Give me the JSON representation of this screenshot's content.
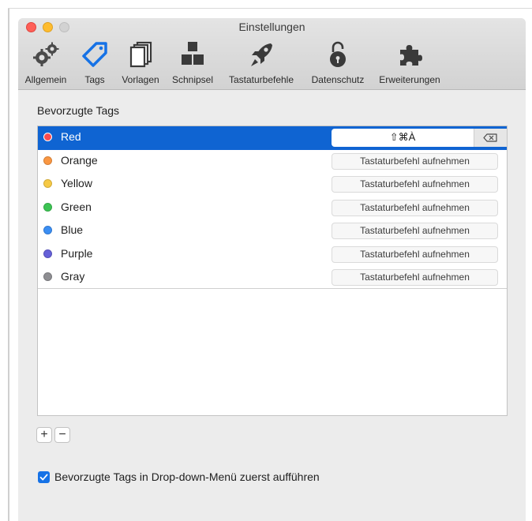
{
  "window": {
    "title": "Einstellungen"
  },
  "toolbar": {
    "items": [
      {
        "label": "Allgemein",
        "icon": "gears-icon"
      },
      {
        "label": "Tags",
        "icon": "tag-icon",
        "active_color": "#1672e6"
      },
      {
        "label": "Vorlagen",
        "icon": "documents-icon"
      },
      {
        "label": "Schnipsel",
        "icon": "blocks-icon"
      },
      {
        "label": "Tastaturbefehle",
        "icon": "rocket-icon"
      },
      {
        "label": "Datenschutz",
        "icon": "padlock-icon"
      },
      {
        "label": "Erweiterungen",
        "icon": "puzzle-icon"
      }
    ]
  },
  "section": {
    "title": "Bevorzugte Tags"
  },
  "tags": [
    {
      "name": "Red",
      "color": "#fb4b4e",
      "shortcut": "⇧⌘À",
      "selected": true
    },
    {
      "name": "Orange",
      "color": "#fa9742",
      "shortcut": "Tastaturbefehl aufnehmen"
    },
    {
      "name": "Yellow",
      "color": "#f6c945",
      "shortcut": "Tastaturbefehl aufnehmen"
    },
    {
      "name": "Green",
      "color": "#3cc453",
      "shortcut": "Tastaturbefehl aufnehmen"
    },
    {
      "name": "Blue",
      "color": "#3b8ef3",
      "shortcut": "Tastaturbefehl aufnehmen"
    },
    {
      "name": "Purple",
      "color": "#6560d8",
      "shortcut": "Tastaturbefehl aufnehmen"
    },
    {
      "name": "Gray",
      "color": "#8e8e92",
      "shortcut": "Tastaturbefehl aufnehmen"
    }
  ],
  "list_controls": {
    "add_label": "+",
    "remove_label": "−"
  },
  "option": {
    "label": "Bevorzugte Tags in Drop-down-Menü zuerst aufführen",
    "checked": true
  },
  "colors": {
    "selection": "#0f64d2",
    "accent": "#1672e6"
  }
}
